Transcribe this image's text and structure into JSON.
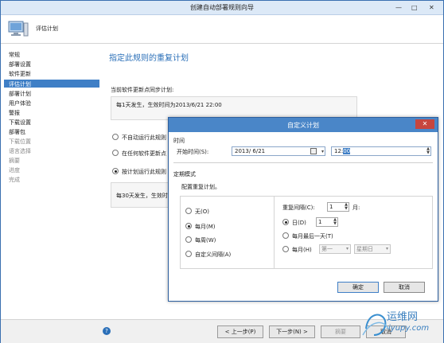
{
  "window": {
    "title": "创建自动部署规则向导",
    "min_glyph": "—",
    "max_glyph": "□",
    "close_glyph": "✕"
  },
  "header": {
    "title": "评估计划"
  },
  "sidebar": {
    "items": [
      {
        "label": "常规"
      },
      {
        "label": "部署设置"
      },
      {
        "label": "软件更新"
      },
      {
        "label": "评估计划"
      },
      {
        "label": "部署计划"
      },
      {
        "label": "用户体验"
      },
      {
        "label": "警报"
      },
      {
        "label": "下载设置"
      },
      {
        "label": "部署包"
      },
      {
        "label": "下载位置"
      },
      {
        "label": "语言选择"
      },
      {
        "label": "摘要"
      },
      {
        "label": "进度"
      },
      {
        "label": "完成"
      }
    ]
  },
  "main": {
    "heading": "指定此规则的重复计划",
    "sync_label": "当前软件更新点同步计划:",
    "sync_value": "每1天发生，生效时间为2013/6/21 22:00",
    "opt_no_run": "不自动运行此规则",
    "opt_after_sync": "在任何软件更新点",
    "opt_schedule": "按计划运行此规则",
    "schedule_value": "每30天发生，生效时间"
  },
  "footer": {
    "help": "?",
    "prev": "< 上一步(P)",
    "next": "下一步(N) >",
    "summary": "摘要",
    "cancel": "取消"
  },
  "dialog": {
    "title": "自定义计划",
    "close_glyph": "✕",
    "time_section": "时间",
    "start_label": "开始时间(S):",
    "start_date": "2013/ 6/21",
    "start_time_prefix": "12:",
    "start_time_selected": "00",
    "pattern_section": "定期模式",
    "configure_label": "配置重复计划。",
    "opt_none": "无(O)",
    "opt_monthly": "每月(M)",
    "opt_weekly": "每周(W)",
    "opt_custom": "自定义间隔(A)",
    "recur_label": "重复间隔(C):",
    "recur_value": "1",
    "recur_unit": "月:",
    "day_label": "日(D)",
    "day_value": "1",
    "last_day": "每月最后一天(T)",
    "every_month": "每月(H)",
    "week_ordinal": "第一",
    "weekday": "星期日",
    "ok": "确定",
    "cancel": "取消"
  },
  "watermark": {
    "brand": "运维网",
    "url": "iyupy.com"
  }
}
